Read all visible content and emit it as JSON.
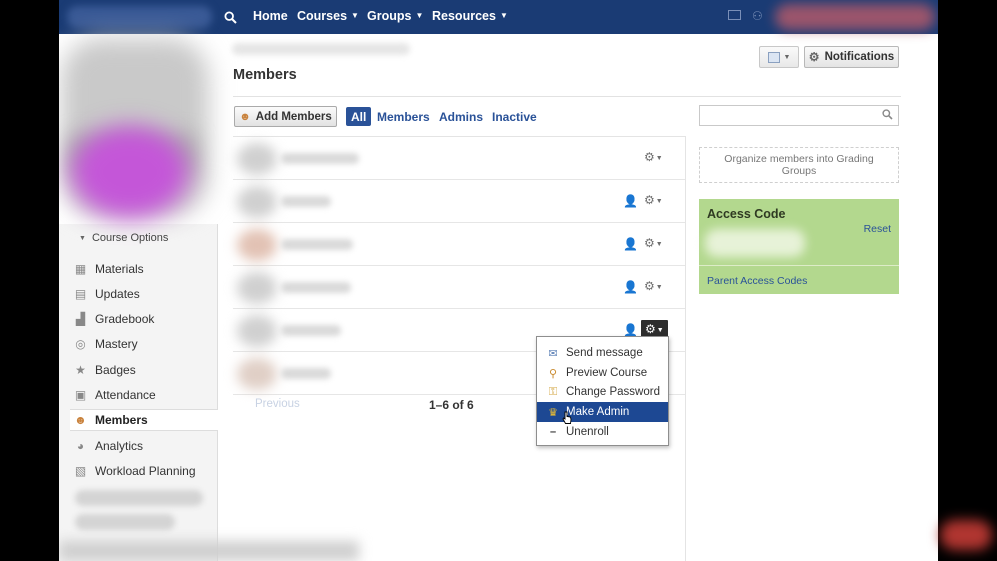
{
  "topnav": {
    "items": [
      {
        "label": "Home",
        "has_caret": false
      },
      {
        "label": "Courses",
        "has_caret": true
      },
      {
        "label": "Groups",
        "has_caret": true
      },
      {
        "label": "Resources",
        "has_caret": true
      }
    ],
    "bg_color": "#1a3b74"
  },
  "sidebar": {
    "course_options_label": "Course Options",
    "items": [
      {
        "label": "Materials",
        "icon": "materials-icon"
      },
      {
        "label": "Updates",
        "icon": "updates-icon"
      },
      {
        "label": "Gradebook",
        "icon": "gradebook-icon"
      },
      {
        "label": "Mastery",
        "icon": "mastery-icon"
      },
      {
        "label": "Badges",
        "icon": "badges-icon"
      },
      {
        "label": "Attendance",
        "icon": "attendance-icon"
      },
      {
        "label": "Members",
        "icon": "members-icon",
        "active": true
      },
      {
        "label": "Analytics",
        "icon": "analytics-icon"
      },
      {
        "label": "Workload Planning",
        "icon": "workload-icon"
      }
    ]
  },
  "header": {
    "title": "Members",
    "notifications_label": "Notifications"
  },
  "toolbar": {
    "add_members_label": "Add Members",
    "filters": [
      {
        "label": "All",
        "active": true
      },
      {
        "label": "Members",
        "active": false
      },
      {
        "label": "Admins",
        "active": false
      },
      {
        "label": "Inactive",
        "active": false
      }
    ],
    "search_placeholder": ""
  },
  "members": {
    "rows": [
      {
        "has_admin_icon": false,
        "menu_open": false
      },
      {
        "has_admin_icon": true,
        "menu_open": false
      },
      {
        "has_admin_icon": true,
        "menu_open": false
      },
      {
        "has_admin_icon": true,
        "menu_open": false
      },
      {
        "has_admin_icon": true,
        "menu_open": true
      },
      {
        "has_admin_icon": false,
        "menu_open": false
      }
    ]
  },
  "pagination": {
    "previous_label": "Previous",
    "count_label": "1–6 of 6"
  },
  "row_menu": {
    "items": [
      {
        "label": "Send message",
        "icon": "envelope-icon",
        "highlighted": false
      },
      {
        "label": "Preview Course",
        "icon": "magnifier-icon",
        "highlighted": false
      },
      {
        "label": "Change Password",
        "icon": "key-icon",
        "highlighted": false
      },
      {
        "label": "Make Admin",
        "icon": "crown-icon",
        "highlighted": true
      },
      {
        "label": "Unenroll",
        "icon": "minus-icon",
        "highlighted": false
      }
    ],
    "highlight_color": "#1d4893"
  },
  "right_panel": {
    "grading_groups_label": "Organize members into Grading Groups",
    "access_code_title": "Access Code",
    "reset_label": "Reset",
    "parent_codes_label": "Parent Access Codes",
    "access_bg_color": "#b3d88e"
  }
}
